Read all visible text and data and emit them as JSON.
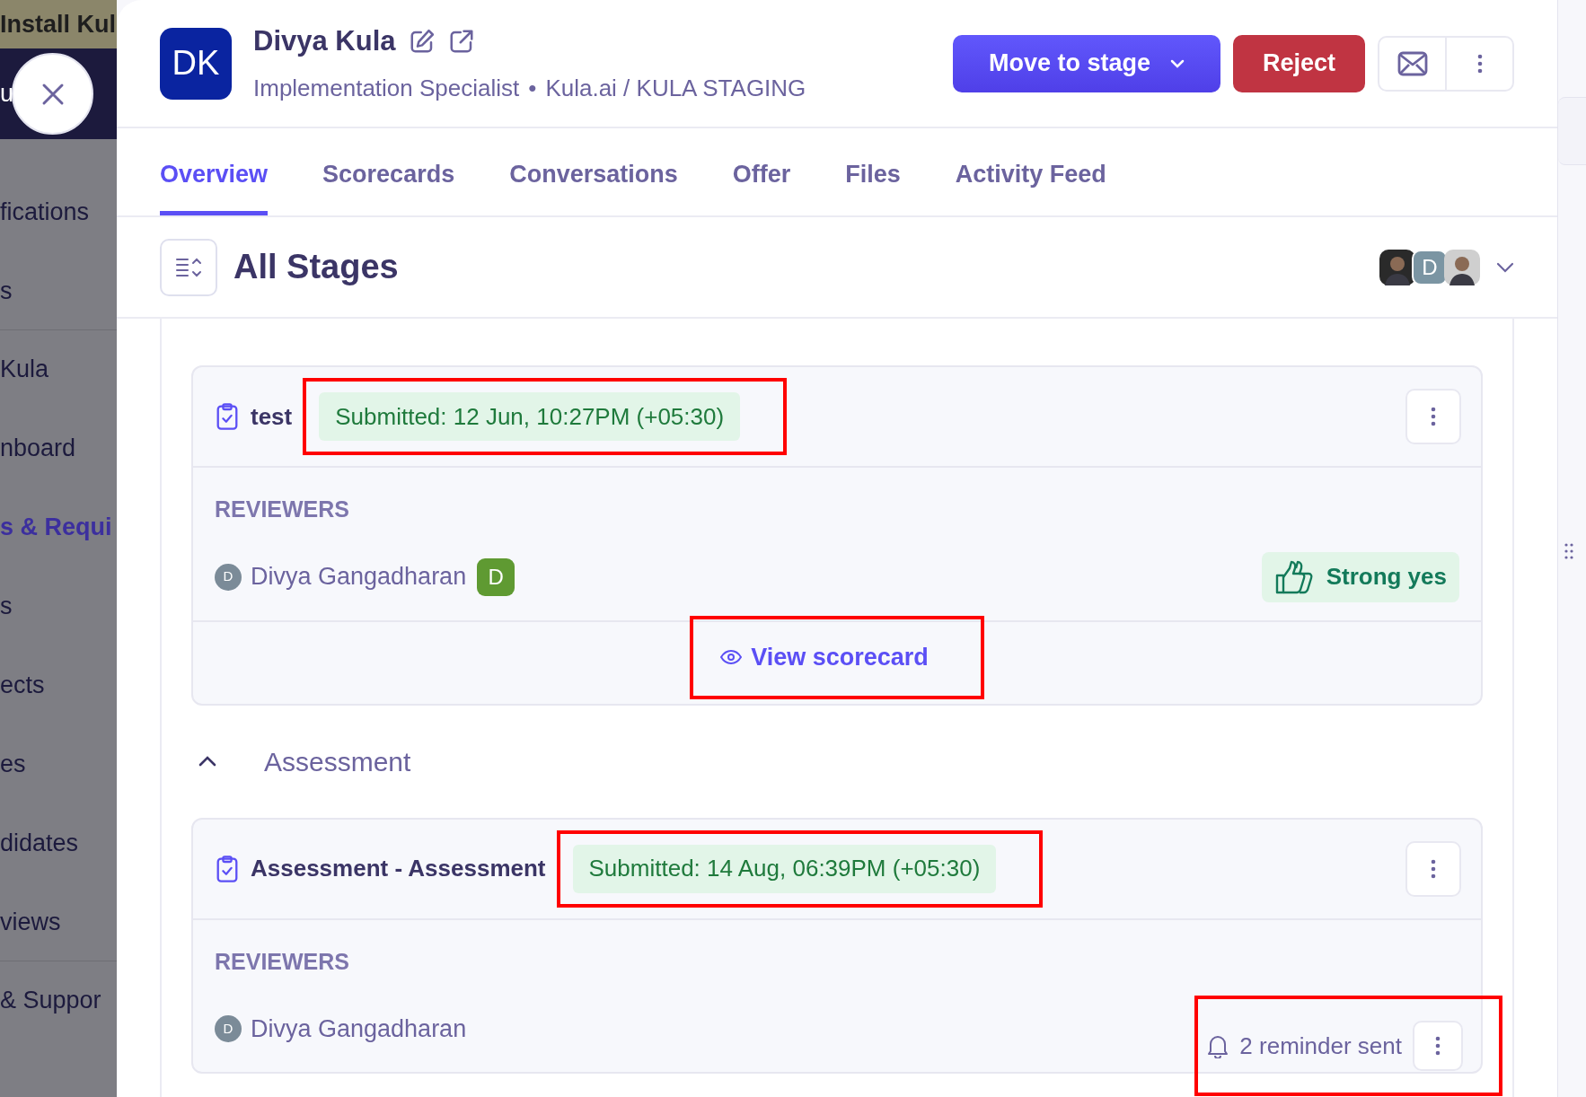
{
  "sidebar": {
    "banner": "Install Kul",
    "banner_2": "u",
    "groups": [
      [
        {
          "label": "fications",
          "selected": false
        },
        {
          "label": "s",
          "selected": false
        }
      ],
      [
        {
          "label": "Kula",
          "selected": false
        },
        {
          "label": "nboard",
          "selected": false
        },
        {
          "label": "s & Requi",
          "selected": true
        },
        {
          "label": "s",
          "selected": false
        },
        {
          "label": "ects",
          "selected": false
        },
        {
          "label": "es",
          "selected": false
        },
        {
          "label": "didates",
          "selected": false
        },
        {
          "label": "views",
          "selected": false
        }
      ],
      [
        {
          "label": "& Suppor",
          "selected": false
        }
      ]
    ]
  },
  "candidate": {
    "initials": "DK",
    "name": "Divya Kula",
    "role": "Implementation Specialist",
    "separator": "•",
    "company": "Kula.ai / KULA STAGING"
  },
  "actions": {
    "move": "Move to stage",
    "reject": "Reject"
  },
  "tabs": [
    {
      "label": "Overview",
      "selected": true
    },
    {
      "label": "Scorecards",
      "selected": false
    },
    {
      "label": "Conversations",
      "selected": false
    },
    {
      "label": "Offer",
      "selected": false
    },
    {
      "label": "Files",
      "selected": false
    },
    {
      "label": "Activity Feed",
      "selected": false
    }
  ],
  "stages_title": "All Stages",
  "participants": [
    {
      "kind": "photo"
    },
    {
      "kind": "initial",
      "initial": "D"
    },
    {
      "kind": "photo"
    }
  ],
  "sections": [
    {
      "card": {
        "title": "test",
        "submitted": "Submitted: 12 Jun, 10:27PM (+05:30)",
        "submitted_highlighted": true,
        "reviewers_label": "REVIEWERS",
        "reviewer": {
          "initial": "D",
          "name": "Divya Gangadharan",
          "badge": "D",
          "verdict": "Strong yes"
        },
        "footer_link": "View scorecard",
        "footer_highlighted": true
      }
    },
    {
      "heading": "Assessment",
      "expanded": true,
      "card": {
        "title": "Assessment - Assessment",
        "submitted": "Submitted: 14 Aug, 06:39PM (+05:30)",
        "submitted_highlighted": true,
        "reviewers_label": "REVIEWERS",
        "reviewer": {
          "initial": "D",
          "name": "Divya Gangadharan",
          "reminder": "2 reminder sent",
          "reminder_highlighted": true
        }
      }
    }
  ]
}
